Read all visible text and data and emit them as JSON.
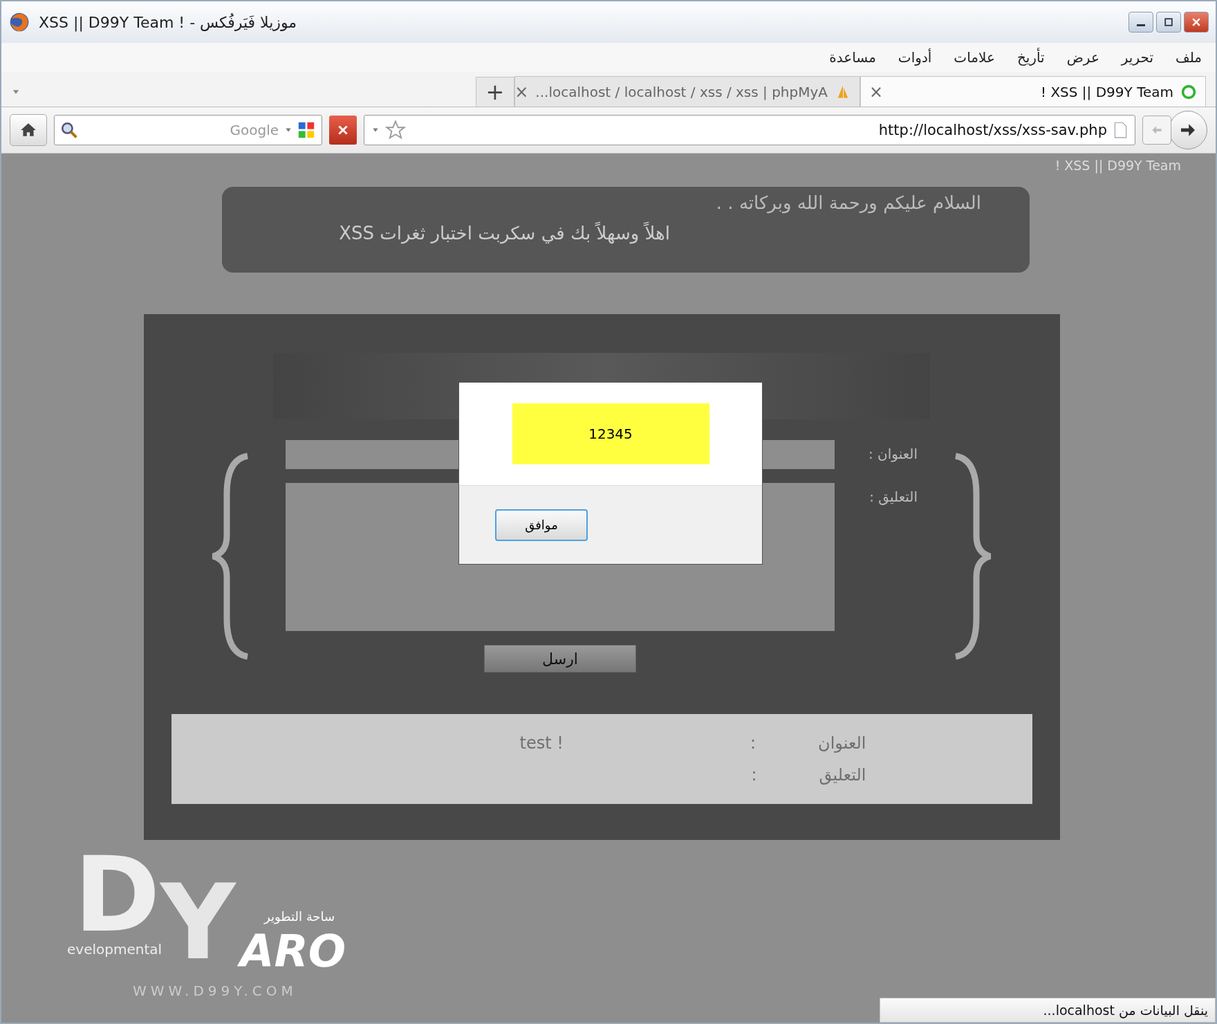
{
  "window": {
    "title": "XSS || D99Y Team ! - موزيلا فَيَرفُكس"
  },
  "menu": [
    "ملف",
    "تحرير",
    "عرض",
    "تأريخ",
    "علامات",
    "أدوات",
    "مساعدة"
  ],
  "tabs": [
    {
      "label": "! XSS || D99Y Team",
      "selected": true,
      "kind": "loading"
    },
    {
      "label": "...localhost / localhost / xss / xss | phpMyA",
      "selected": false,
      "kind": "pma"
    }
  ],
  "tab_close": "×",
  "new_tab": "+",
  "address": {
    "value": "http://localhost/xss/xss-sav.php"
  },
  "search": {
    "placeholder": "Google"
  },
  "page": {
    "ghost_tab_title": "! XSS || D99Y Team",
    "greeting": "السلام عليكم ورحمة الله وبركاته . .",
    "welcome": "اهلاً وسهلاً بك في سكربت اختبار ثغرات XSS",
    "form": {
      "title_label": "العنوان :",
      "comment_label": "التعليق :",
      "submit": "ارسل"
    },
    "results": [
      {
        "label": "العنوان",
        "sep": ":",
        "value": "test !"
      },
      {
        "label": "التعليق",
        "sep": ":"
      }
    ],
    "logo": {
      "big_d": "D",
      "evelopmental": "evelopmental",
      "big_y": "Y",
      "aro": "ARO",
      "arabic": "ساحة التطوير",
      "url": "WWW.D99Y.COM"
    }
  },
  "dialog": {
    "message": "12345",
    "button": "موافق"
  },
  "status_bar": {
    "text": "ينقل البيانات من localhost..."
  }
}
